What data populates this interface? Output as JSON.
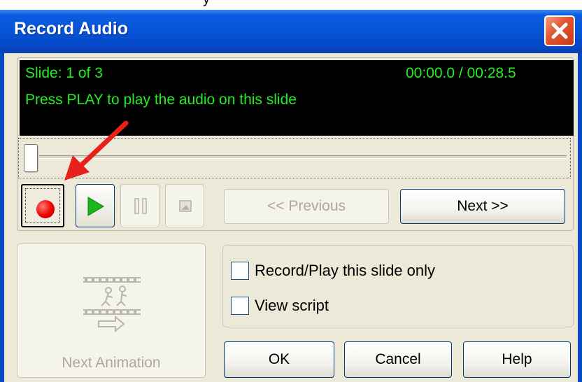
{
  "title_strip_fragment": "y",
  "window": {
    "title": "Record Audio"
  },
  "display": {
    "slide_status": "Slide: 1 of 3",
    "time_readout": "00:00.0 / 00:28.5",
    "instruction": "Press PLAY to play the audio on this slide"
  },
  "playback": {
    "position_fraction": 0.0
  },
  "navigation": {
    "previous_label": "<< Previous",
    "next_label": "Next >>"
  },
  "next_animation": {
    "label": "Next Animation"
  },
  "options": {
    "record_play_label": "Record/Play this slide only",
    "record_play_checked": false,
    "view_script_label": "View script",
    "view_script_checked": false
  },
  "dialog_buttons": {
    "ok_label": "OK",
    "cancel_label": "Cancel",
    "help_label": "Help"
  },
  "colors": {
    "display_text": "#22ee22",
    "annotation_arrow": "#e8201a",
    "titlebar": "#0653d6"
  }
}
